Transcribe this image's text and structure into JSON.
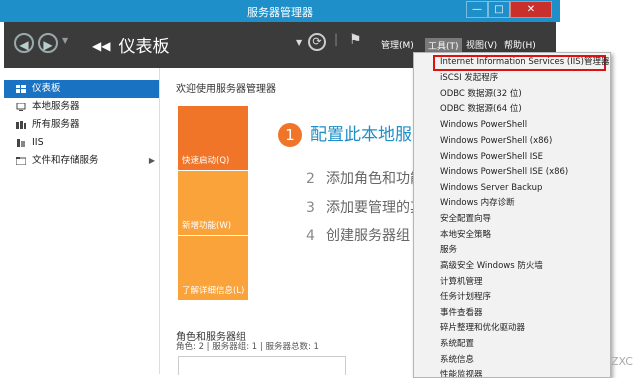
{
  "window": {
    "title": "服务器管理器",
    "minimize": "—",
    "maximize": "□",
    "close": "✕"
  },
  "toolbar": {
    "back_icon": "back-arrow-icon",
    "forward_icon": "forward-arrow-icon",
    "breadcrumb": "仪表板",
    "menus": [
      {
        "label": "管理(M)"
      },
      {
        "label": "工具(T)"
      },
      {
        "label": "视图(V)"
      },
      {
        "label": "帮助(H)"
      }
    ]
  },
  "sidebar": {
    "items": [
      {
        "label": "仪表板",
        "icon": "dashboard-icon",
        "selected": true
      },
      {
        "label": "本地服务器",
        "icon": "local-server-icon"
      },
      {
        "label": "所有服务器",
        "icon": "all-servers-icon"
      },
      {
        "label": "IIS",
        "icon": "iis-icon"
      },
      {
        "label": "文件和存储服务",
        "icon": "storage-icon",
        "arrow": "▶"
      }
    ]
  },
  "main": {
    "welcome": "欢迎使用服务器管理器",
    "tiles": [
      {
        "label": "快速启动(Q)",
        "color": "#f07528"
      },
      {
        "label": "新增功能(W)",
        "color": "#f9a33a"
      },
      {
        "label": "了解详细信息(L)",
        "color": "#f9a33a"
      }
    ],
    "steps": [
      {
        "num": "1",
        "label": "配置此本地服"
      },
      {
        "num": "2",
        "label": "添加角色和功能"
      },
      {
        "num": "3",
        "label": "添加要管理的其"
      },
      {
        "num": "4",
        "label": "创建服务器组"
      }
    ],
    "roles_title": "角色和服务器组",
    "roles_summary": "角色: 2 | 服务器组: 1 | 服务器总数: 1"
  },
  "tools_menu": {
    "items": [
      "Internet Information Services (IIS)管理器",
      "iSCSI 发起程序",
      "ODBC 数据源(32 位)",
      "ODBC 数据源(64 位)",
      "Windows PowerShell",
      "Windows PowerShell (x86)",
      "Windows PowerShell ISE",
      "Windows PowerShell ISE (x86)",
      "Windows Server Backup",
      "Windows 内存诊断",
      "安全配置向导",
      "本地安全策略",
      "服务",
      "高级安全 Windows 防火墙",
      "计算机管理",
      "任务计划程序",
      "事件查看器",
      "碎片整理和优化驱动器",
      "系统配置",
      "系统信息",
      "性能监视器"
    ]
  },
  "watermark": "ZXC",
  "colors": {
    "titlebar": "#1e8fc8",
    "toolbar": "#3b3b3b",
    "selected": "#1a73c2",
    "orange": "#f07528",
    "amber": "#f9a33a",
    "highlight": "#dd1111"
  }
}
